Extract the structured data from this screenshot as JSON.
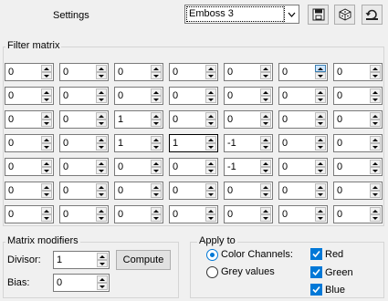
{
  "header": {
    "title": "Settings",
    "preset": "Emboss 3",
    "icons": [
      "chevron-down-icon",
      "save-icon",
      "dice-icon",
      "reset-icon"
    ]
  },
  "matrix": {
    "title": "Filter matrix",
    "rows": [
      [
        "0",
        "0",
        "0",
        "0",
        "0",
        "0",
        "0"
      ],
      [
        "0",
        "0",
        "0",
        "0",
        "0",
        "0",
        "0"
      ],
      [
        "0",
        "0",
        "1",
        "0",
        "0",
        "0",
        "0"
      ],
      [
        "0",
        "0",
        "1",
        "1",
        "-1",
        "0",
        "0"
      ],
      [
        "0",
        "0",
        "0",
        "0",
        "-1",
        "0",
        "0"
      ],
      [
        "0",
        "0",
        "0",
        "0",
        "0",
        "0",
        "0"
      ],
      [
        "0",
        "0",
        "0",
        "0",
        "0",
        "0",
        "0"
      ]
    ]
  },
  "modifiers": {
    "title": "Matrix modifiers",
    "divisor_label": "Divisor:",
    "divisor": "1",
    "compute_label": "Compute",
    "bias_label": "Bias:",
    "bias": "0"
  },
  "apply": {
    "title": "Apply to",
    "color_channels": "Color Channels:",
    "grey_values": "Grey values",
    "red": "Red",
    "green": "Green",
    "blue": "Blue",
    "selected": "color_channels",
    "checked": [
      "red",
      "green",
      "blue"
    ]
  },
  "colors": {
    "accent": "#0078d7",
    "border": "#7a7a7a",
    "background": "#f0f0f0"
  }
}
